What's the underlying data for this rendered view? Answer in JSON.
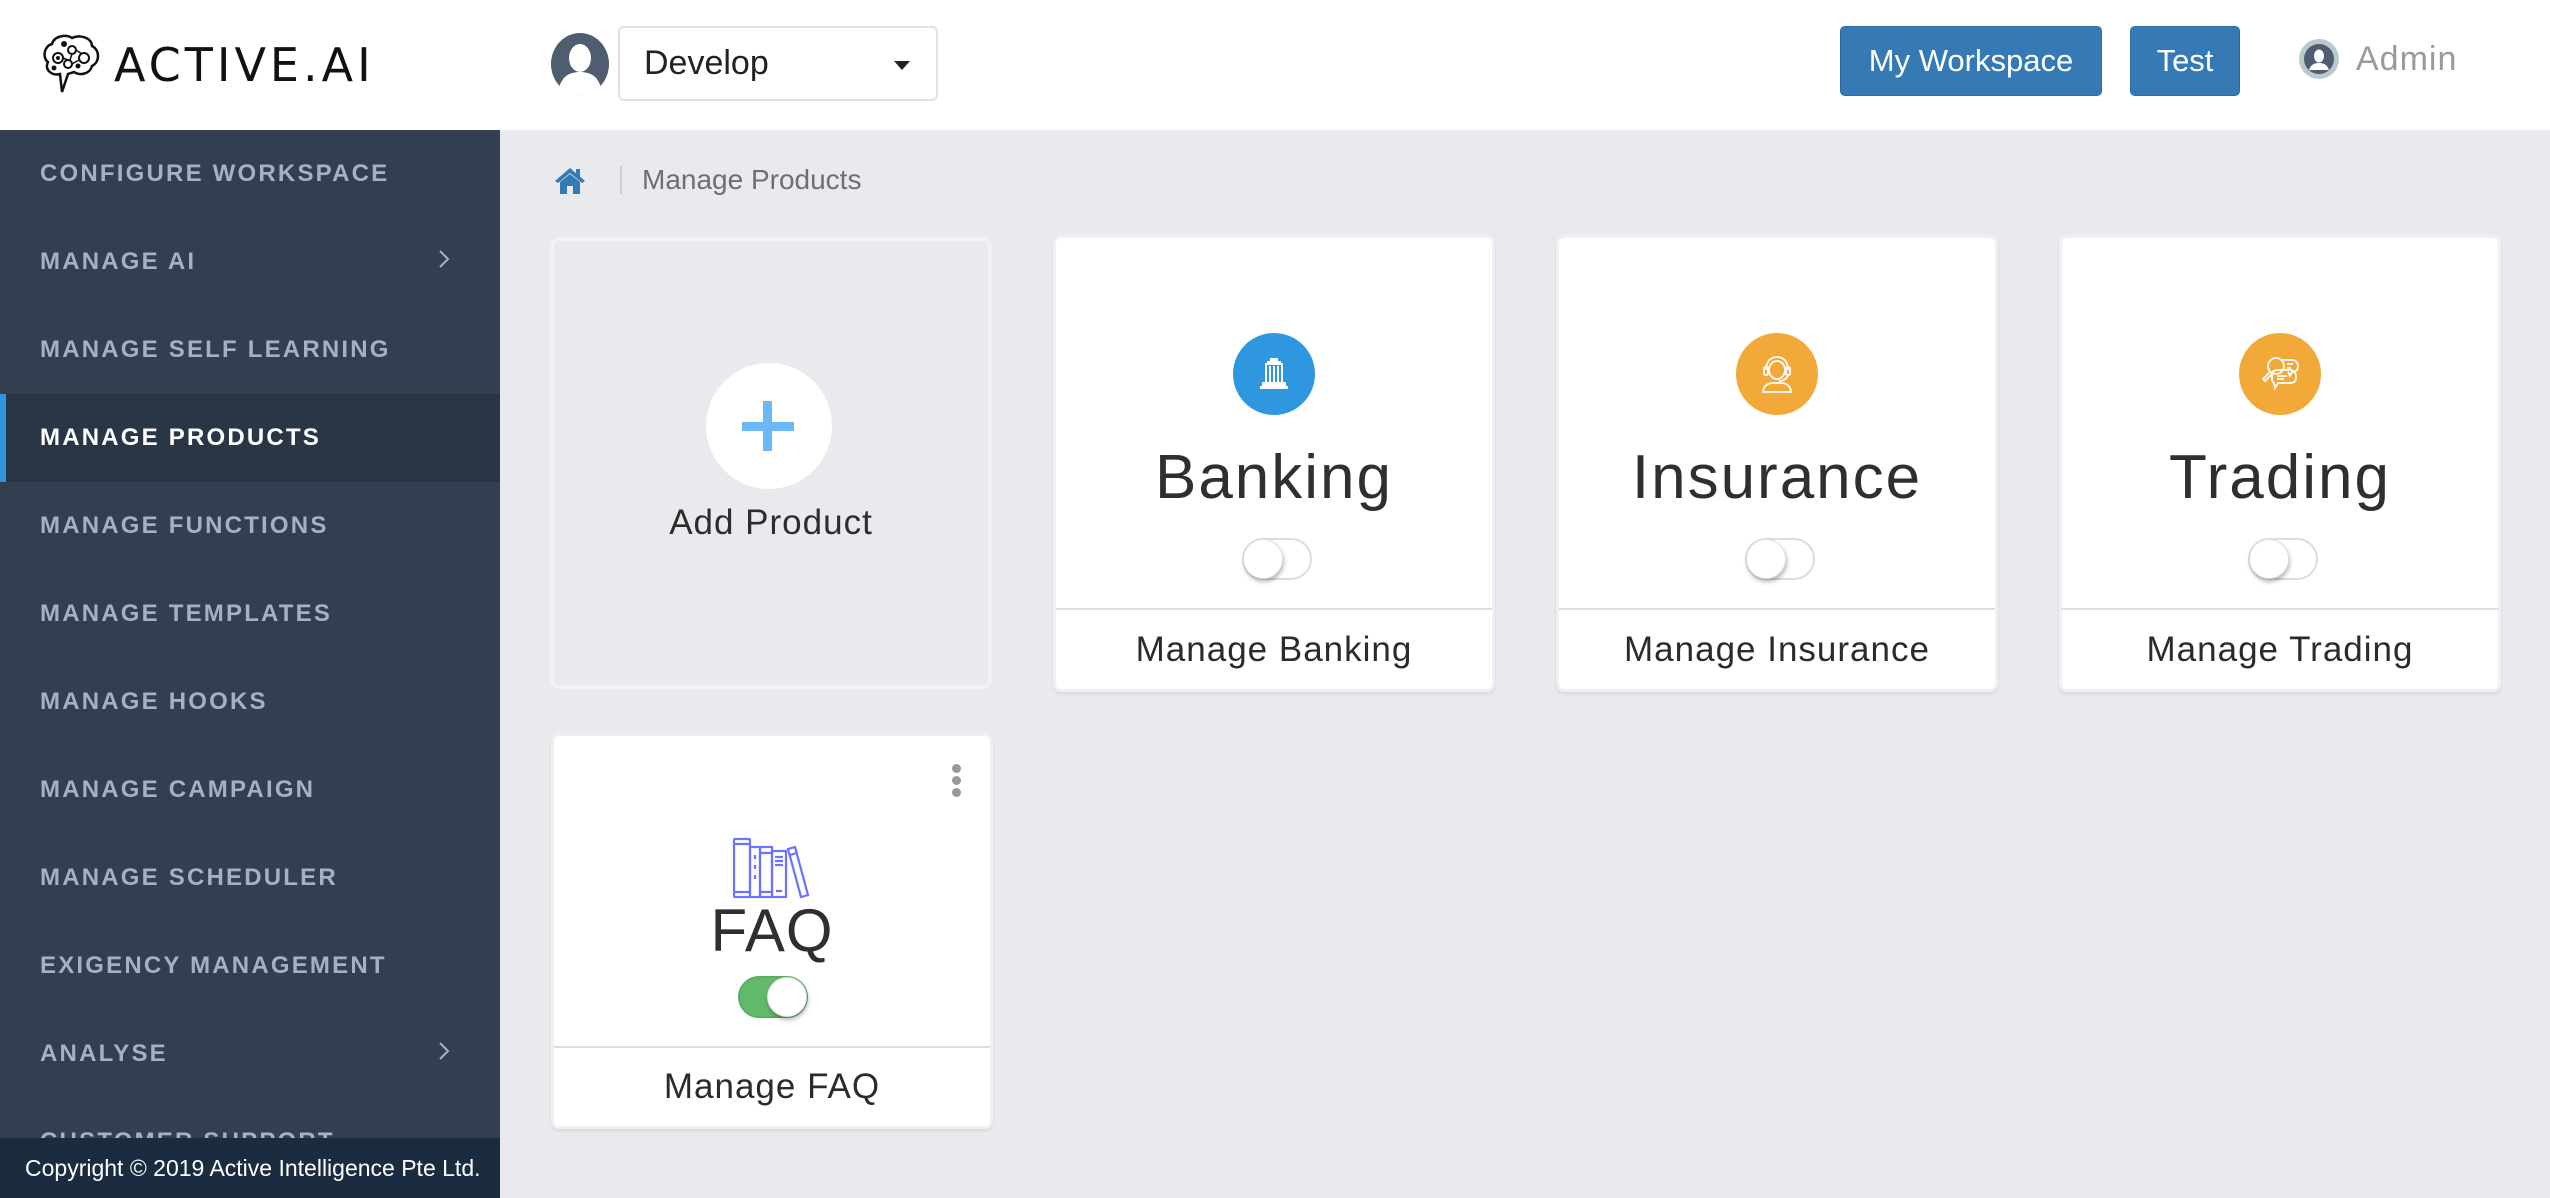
{
  "header": {
    "logo_text": "ACTIVE.AI",
    "workspace_select": {
      "value": "Develop"
    },
    "buttons": {
      "my_workspace": "My Workspace",
      "test": "Test"
    },
    "user": {
      "name": "Admin"
    }
  },
  "sidebar": {
    "items": [
      {
        "label": "CONFIGURE WORKSPACE",
        "has_submenu": false,
        "active": false
      },
      {
        "label": "MANAGE AI",
        "has_submenu": true,
        "active": false
      },
      {
        "label": "MANAGE SELF LEARNING",
        "has_submenu": false,
        "active": false
      },
      {
        "label": "MANAGE PRODUCTS",
        "has_submenu": false,
        "active": true
      },
      {
        "label": "MANAGE FUNCTIONS",
        "has_submenu": false,
        "active": false
      },
      {
        "label": "MANAGE TEMPLATES",
        "has_submenu": false,
        "active": false
      },
      {
        "label": "MANAGE HOOKS",
        "has_submenu": false,
        "active": false
      },
      {
        "label": "MANAGE CAMPAIGN",
        "has_submenu": false,
        "active": false
      },
      {
        "label": "MANAGE SCHEDULER",
        "has_submenu": false,
        "active": false
      },
      {
        "label": "EXIGENCY MANAGEMENT",
        "has_submenu": false,
        "active": false
      },
      {
        "label": "ANALYSE",
        "has_submenu": true,
        "active": false
      },
      {
        "label": "CUSTOMER SUPPORT",
        "has_submenu": false,
        "active": false
      }
    ],
    "copyright": "Copyright © 2019 Active Intelligence Pte Ltd."
  },
  "breadcrumb": {
    "home_icon": "home-icon",
    "current": "Manage Products"
  },
  "add_product": {
    "label": "Add Product",
    "icon": "plus-icon"
  },
  "products": [
    {
      "name": "Banking",
      "icon": "bank-building-icon",
      "icon_color": "#2f97e0",
      "enabled": false,
      "manage_label": "Manage Banking"
    },
    {
      "name": "Insurance",
      "icon": "headset-agent-icon",
      "icon_color": "#f3a93a",
      "enabled": false,
      "manage_label": "Manage Insurance"
    },
    {
      "name": "Trading",
      "icon": "search-chat-icon",
      "icon_color": "#f3a93a",
      "enabled": false,
      "manage_label": "Manage Trading"
    },
    {
      "name": "FAQ",
      "icon": "books-icon",
      "icon_color": "#6b72ff",
      "enabled": true,
      "manage_label": "Manage FAQ"
    }
  ],
  "colors": {
    "primary_button": "#3579b5",
    "sidebar_bg": "#323f50",
    "sidebar_active_accent": "#2f96dd",
    "toggle_on": "#62b96a"
  }
}
